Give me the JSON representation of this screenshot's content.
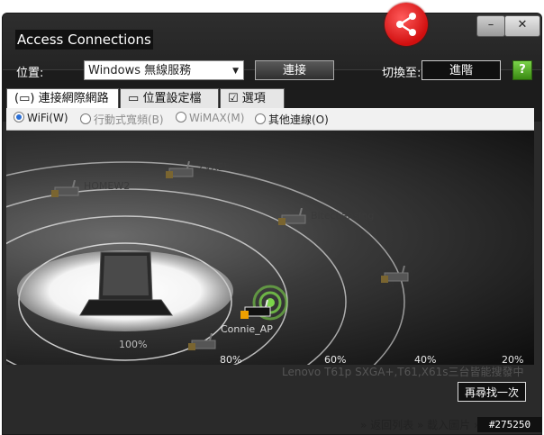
{
  "window": {
    "title": "Access Connections"
  },
  "toolbar": {
    "location_label": "位置:",
    "location_value": "Windows 無線服務",
    "connect_label": "連接",
    "switch_to_label": "切換至:",
    "advanced_label": "進階"
  },
  "tabs": [
    {
      "label": "連接網際網路",
      "icon": "network-icon",
      "active": true
    },
    {
      "label": "位置設定檔",
      "icon": "profile-icon",
      "active": false
    },
    {
      "label": "選項",
      "icon": "checkbox-icon",
      "active": false
    }
  ],
  "connection_types": [
    {
      "label": "WiFi(W)",
      "selected": true,
      "enabled": true
    },
    {
      "label": "行動式寬頻(B)",
      "selected": false,
      "enabled": false
    },
    {
      "label": "WiMAX(M)",
      "selected": false,
      "enabled": false
    },
    {
      "label": "其他連線(O)",
      "selected": false,
      "enabled": true
    }
  ],
  "signal_rings": [
    "100%",
    "80%",
    "60%",
    "40%",
    "20%"
  ],
  "access_points": [
    {
      "name": "HOMEW2",
      "locked": true
    },
    {
      "name": "ZyXEL",
      "locked": true
    },
    {
      "name": "BitecLansing",
      "locked": true
    },
    {
      "name": "Connie_AP",
      "locked": true,
      "connected": true
    },
    {
      "name": "",
      "locked": true
    },
    {
      "name": "",
      "locked": true
    }
  ],
  "footer": {
    "ghost_text": "Lenovo T61p SXGA+,T61,X61s三台皆能搜發中",
    "refresh_label": "再尋找一次",
    "links": "» 返回列表 » 載入圖片 » ",
    "watermark": "#275250"
  },
  "colors": {
    "accent_red": "#d10f0f",
    "help_green": "#3a8a12",
    "wifi_green": "#7bd34a"
  }
}
